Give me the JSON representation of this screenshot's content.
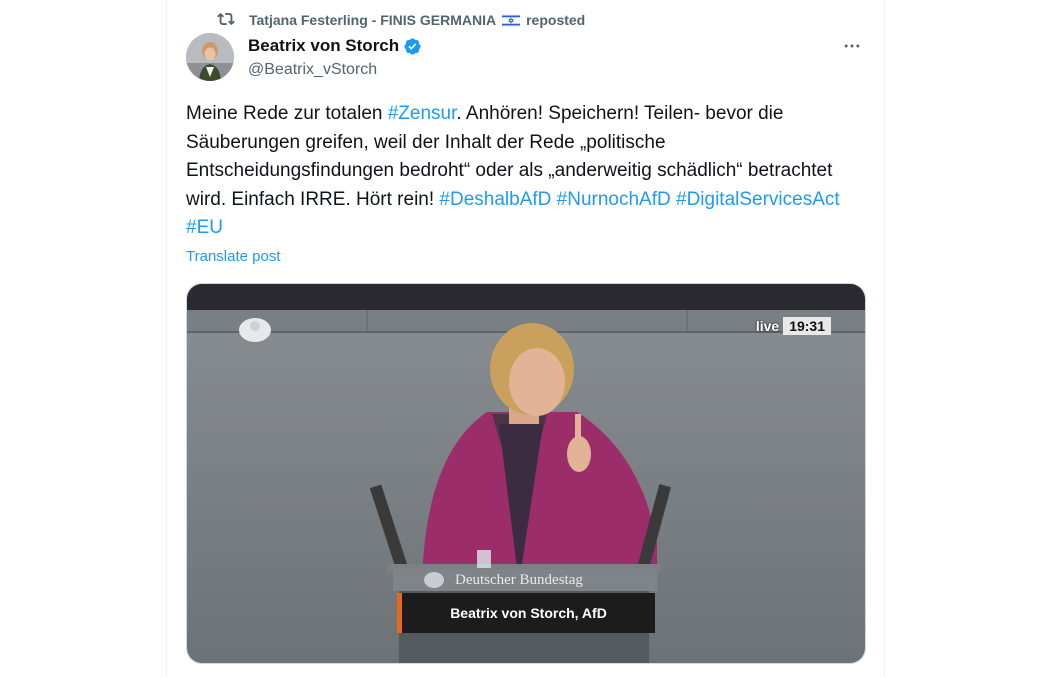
{
  "repost": {
    "icon": "repost-icon",
    "name": "Tatjana Festerling - FINIS GERMANIA",
    "flag": "israel-flag",
    "suffix": "reposted"
  },
  "author": {
    "display_name": "Beatrix von Storch",
    "handle": "@Beatrix_vStorch",
    "verified": true,
    "verified_color": "#1d9bf0"
  },
  "post": {
    "segments": [
      {
        "text": "Meine Rede zur totalen ",
        "tag": false
      },
      {
        "text": "#Zensur",
        "tag": true
      },
      {
        "text": ". Anhören! Speichern! Teilen- bevor die Säuberungen greifen, weil der Inhalt der Rede „politische Entscheidungsfindungen bedroht“ oder als „anderweitig schädlich“ betrachtet wird. Einfach IRRE. Hört rein! ",
        "tag": false
      },
      {
        "text": "#DeshalbAfD",
        "tag": true
      },
      {
        "text": " ",
        "tag": false
      },
      {
        "text": "#NurnochAfD",
        "tag": true
      },
      {
        "text": " ",
        "tag": false
      },
      {
        "text": "#DigitalServicesAct",
        "tag": true
      },
      {
        "text": " ",
        "tag": false
      },
      {
        "text": "#EU",
        "tag": true
      }
    ],
    "translate_label": "Translate post"
  },
  "media": {
    "live_label": "live",
    "time": "19:31",
    "plate_text": "Deutscher Bundestag",
    "name_strip": "Beatrix von Storch, AfD",
    "accent_color": "#e36a1c"
  },
  "colors": {
    "link": "#1d9bf0",
    "secondary_text": "#536471",
    "primary_text": "#0f1419"
  }
}
